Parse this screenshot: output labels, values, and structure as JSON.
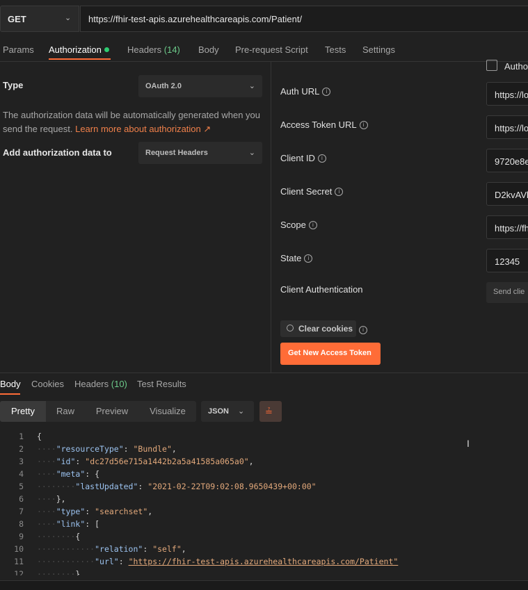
{
  "request": {
    "method": "GET",
    "url": "https://fhir-test-apis.azurehealthcareapis.com/Patient/"
  },
  "request_tabs": [
    {
      "label": "Params"
    },
    {
      "label": "Authorization"
    },
    {
      "label": "Headers",
      "count": "(14)"
    },
    {
      "label": "Body"
    },
    {
      "label": "Pre-request Script"
    },
    {
      "label": "Tests"
    },
    {
      "label": "Settings"
    }
  ],
  "auth": {
    "type_label": "Type",
    "type_value": "OAuth 2.0",
    "description": "The authorization data will be automatically generated when you send the request.",
    "learn_more": "Learn more about authorization ↗",
    "add_to_label": "Add authorization data to",
    "add_to_value": "Request Headers"
  },
  "config": {
    "authorize_checkbox_label": "Autho",
    "fields": [
      {
        "label": "Auth URL",
        "value": "https://lo"
      },
      {
        "label": "Access Token URL",
        "value": "https://lo"
      },
      {
        "label": "Client ID",
        "value": "9720e8e"
      },
      {
        "label": "Client Secret",
        "value": "D2kvAVk"
      },
      {
        "label": "Scope",
        "value": "https://fh"
      },
      {
        "label": "State",
        "value": "12345"
      }
    ],
    "client_auth_label": "Client Authentication",
    "client_auth_value": "Send clie",
    "clear_cookies": "Clear cookies",
    "get_token": "Get New Access Token"
  },
  "response_tabs": [
    {
      "label": "Body"
    },
    {
      "label": "Cookies"
    },
    {
      "label": "Headers",
      "count": "(10)"
    },
    {
      "label": "Test Results"
    }
  ],
  "view_modes": [
    "Pretty",
    "Raw",
    "Preview",
    "Visualize"
  ],
  "format": "JSON",
  "code_lines": [
    {
      "n": "1",
      "text": "{"
    },
    {
      "n": "2",
      "key": "\"resourceType\"",
      "val": "\"Bundle\"",
      "tail": ","
    },
    {
      "n": "3",
      "key": "\"id\"",
      "val": "\"dc27d56e715a1442b2a5a41585a065a0\"",
      "tail": ","
    },
    {
      "n": "4",
      "key": "\"meta\"",
      "tail": "{"
    },
    {
      "n": "5",
      "key": "\"lastUpdated\"",
      "val": "\"2021-02-22T09:02:08.9650439+00:00\""
    },
    {
      "n": "6",
      "text": "},"
    },
    {
      "n": "7",
      "key": "\"type\"",
      "val": "\"searchset\"",
      "tail": ","
    },
    {
      "n": "8",
      "key": "\"link\"",
      "tail": "["
    },
    {
      "n": "9",
      "text": "{"
    },
    {
      "n": "10",
      "key": "\"relation\"",
      "val": "\"self\"",
      "tail": ","
    },
    {
      "n": "11",
      "key": "\"url\"",
      "val": "\"https://fhir-test-apis.azurehealthcareapis.com/Patient\""
    },
    {
      "n": "12",
      "text": "}"
    }
  ],
  "colors": {
    "accent": "#ff6c37",
    "count": "#6ccb8a",
    "json_key": "#9cc3f0",
    "json_string": "#e3a97b"
  }
}
